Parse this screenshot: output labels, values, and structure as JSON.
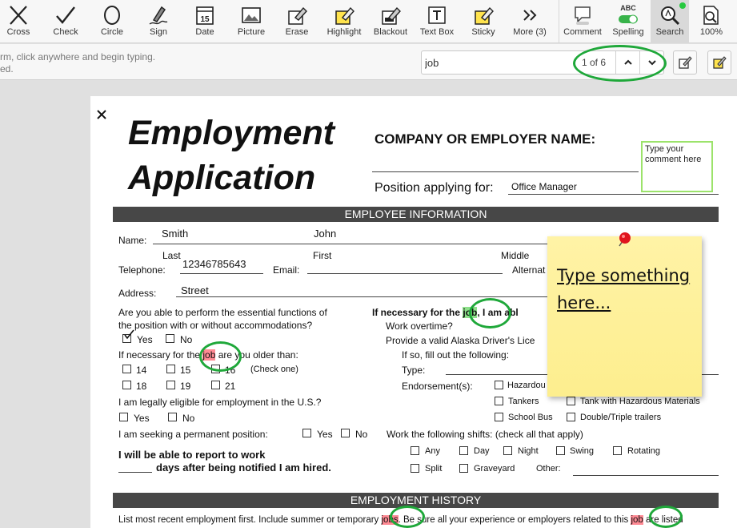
{
  "toolbar": {
    "tools": [
      {
        "label": "Cross",
        "icon": "cross-icon"
      },
      {
        "label": "Check",
        "icon": "check-icon"
      },
      {
        "label": "Circle",
        "icon": "circle-icon"
      },
      {
        "label": "Sign",
        "icon": "sign-icon"
      },
      {
        "label": "Date",
        "icon": "date-icon",
        "day": "15"
      },
      {
        "label": "Picture",
        "icon": "picture-icon"
      },
      {
        "label": "Erase",
        "icon": "erase-icon"
      },
      {
        "label": "Highlight",
        "icon": "highlight-icon"
      },
      {
        "label": "Blackout",
        "icon": "blackout-icon"
      },
      {
        "label": "Text Box",
        "icon": "text-box-icon"
      },
      {
        "label": "Sticky",
        "icon": "sticky-icon"
      },
      {
        "label": "More (3)",
        "icon": "more-icon"
      }
    ],
    "right_tools": [
      {
        "label": "Comment",
        "icon": "comment-icon"
      },
      {
        "label": "Spelling",
        "icon": "spelling-toggle-icon",
        "badge": "ABC"
      },
      {
        "label": "Search",
        "icon": "search-icon"
      },
      {
        "label": "100%",
        "icon": "zoom-icon"
      }
    ]
  },
  "hint": {
    "line1": "rm, click anywhere and begin typing.",
    "line2": "ed."
  },
  "search": {
    "value": "job",
    "count": "1 of 6"
  },
  "doc": {
    "title_line1": "Employment",
    "title_line2": "Application",
    "company_label": "COMPANY OR EMPLOYER NAME:",
    "position_label": "Position applying for:",
    "position_value": "Office Manager",
    "comment_text": "Type your comment here",
    "section1": "EMPLOYEE INFORMATION",
    "name_label": "Name:",
    "last_value": "Smith",
    "first_value": "John",
    "last_label": "Last",
    "first_label": "First",
    "middle_label": "Middle",
    "telephone_label": "Telephone:",
    "telephone_value": "12346785643",
    "email_label": "Email:",
    "alternate_label": "Alternat",
    "address_label": "Address:",
    "address_value": "Street",
    "q_essential_1": "Are you able to perform the essential functions of",
    "q_essential_2": "the position with or without accommodations?",
    "yes": "Yes",
    "no": "No",
    "q_older_pre": "If necessary for the ",
    "q_older_job": "job",
    "q_older_post": " are you older than:",
    "age_14": "14",
    "age_15": "15",
    "age_16": "16",
    "check_one": "(Check one)",
    "age_18": "18",
    "age_19": "19",
    "age_21": "21",
    "q_legal": "I am legally eligible for employment in the U.S.?",
    "q_permanent": "I am seeking a permanent position:",
    "report_1": "I will be able to report to work",
    "report_2": "days after being notified I am hired.",
    "r_nec_pre": "If necessary for the ",
    "r_nec_job": "job",
    "r_nec_post": ", I am abl",
    "r_overtime": "Work overtime?",
    "r_license": "Provide a valid Alaska Driver's Lice",
    "r_if_so": "If so, fill out the following:",
    "r_type": "Type:",
    "r_endorse": "Endorsement(s):",
    "e_hazardous": "Hazardou",
    "e_tankers": "Tankers",
    "e_tank_haz": "Tank with Hazardous Materials",
    "e_school": "School Bus",
    "e_double": "Double/Triple trailers",
    "r_shifts": "Work the following shifts: (check all that apply)",
    "sh_any": "Any",
    "sh_day": "Day",
    "sh_night": "Night",
    "sh_swing": "Swing",
    "sh_rotating": "Rotating",
    "sh_split": "Split",
    "sh_graveyard": "Graveyard",
    "sh_other": "Other:",
    "section2": "EMPLOYMENT HISTORY",
    "hist_1": "List most recent employment first. Include summer or temporary ",
    "hist_jobs1": "jobs",
    "hist_2": ". Be sure all your experience or employers related to this ",
    "hist_job2": "job",
    "hist_3": " are listed"
  },
  "sticky": {
    "text": "Type something here..."
  }
}
